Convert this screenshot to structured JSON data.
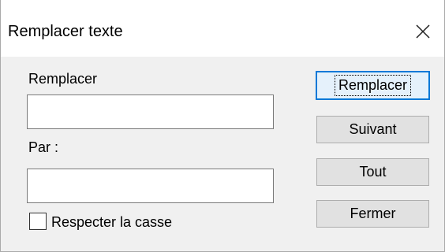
{
  "window": {
    "title": "Remplacer texte",
    "close_icon": "close-icon"
  },
  "form": {
    "find_label": "Remplacer",
    "find_value": "",
    "replace_label": "Par :",
    "replace_value": "",
    "match_case_label": "Respecter la casse",
    "match_case_checked": false
  },
  "buttons": {
    "replace": "Remplacer",
    "next": "Suivant",
    "all": "Tout",
    "close": "Fermer"
  }
}
